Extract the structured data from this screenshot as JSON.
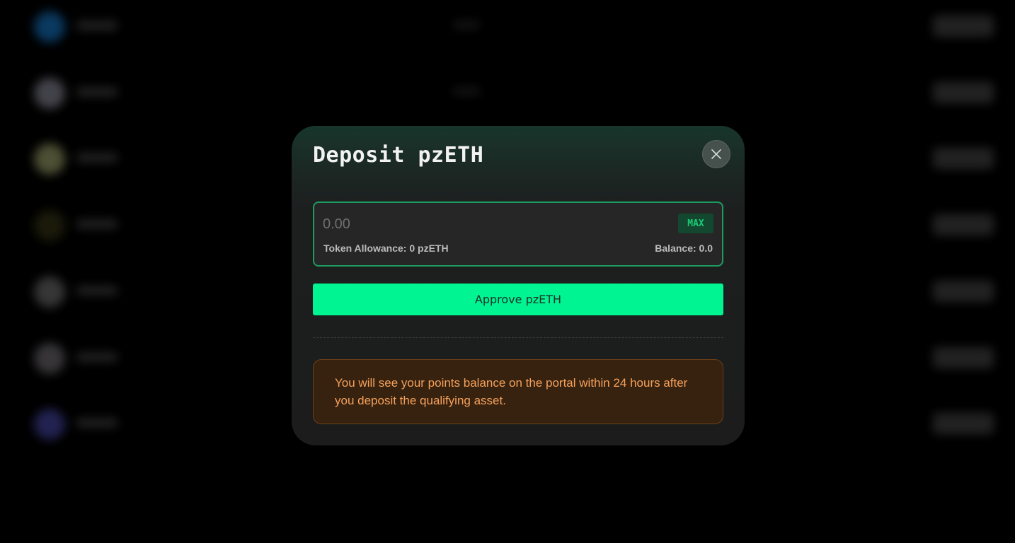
{
  "background": {
    "rows": [
      {
        "avatar_color": "#0c3f6a"
      },
      {
        "avatar_color": "#4a4a52"
      },
      {
        "avatar_color": "#56593a"
      },
      {
        "avatar_color": "#1e1d0c"
      },
      {
        "avatar_color": "#3c3c3c"
      },
      {
        "avatar_color": "#3d3b3e"
      },
      {
        "avatar_color": "#26265a"
      }
    ]
  },
  "modal": {
    "title": "Deposit pzETH",
    "close_icon": "close-icon",
    "input": {
      "value": "",
      "placeholder": "0.00",
      "max_label": "MAX",
      "allowance_text": "Token Allowance: 0 pzETH",
      "balance_text": "Balance: 0.0"
    },
    "approve_label": "Approve pzETH",
    "notice_text": "You will see your points balance on the portal within 24 hours after you deposit the qualifying asset."
  },
  "colors": {
    "accent": "#00f592",
    "input_border": "#1f9a60",
    "notice_text": "#f6a15a",
    "notice_bg": "#372210"
  }
}
